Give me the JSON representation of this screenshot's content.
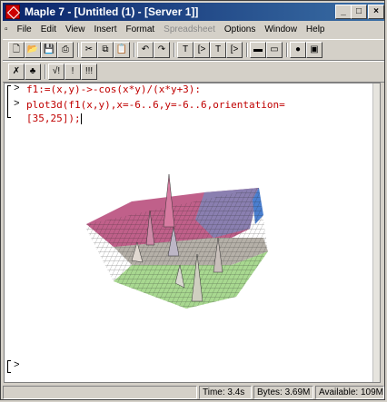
{
  "window": {
    "title": "Maple 7 - [Untitled (1) - [Server 1]]"
  },
  "menu": [
    "File",
    "Edit",
    "View",
    "Insert",
    "Format",
    "Spreadsheet",
    "Options",
    "Window",
    "Help"
  ],
  "menu_disabled": [
    "Spreadsheet"
  ],
  "toolbar1": [
    {
      "name": "new-icon",
      "glyph": "🗋"
    },
    {
      "name": "open-icon",
      "glyph": "📂"
    },
    {
      "name": "save-icon",
      "glyph": "💾"
    },
    {
      "name": "print-icon",
      "glyph": "⎙"
    },
    {
      "name": "cut-icon",
      "glyph": "✂"
    },
    {
      "name": "copy-icon",
      "glyph": "⧉"
    },
    {
      "name": "paste-icon",
      "glyph": "📋"
    },
    {
      "name": "undo-icon",
      "glyph": "↶"
    },
    {
      "name": "redo-icon",
      "glyph": "↷"
    },
    {
      "name": "text-mode-icon",
      "glyph": "T"
    },
    {
      "name": "input-mode-icon",
      "glyph": "[>"
    },
    {
      "name": "insert-text-icon",
      "glyph": "T"
    },
    {
      "name": "new-group-icon",
      "glyph": "[>"
    },
    {
      "name": "collapse-section-icon",
      "glyph": "▬"
    },
    {
      "name": "expand-section-icon",
      "glyph": "▭"
    },
    {
      "name": "stop-icon",
      "glyph": "●"
    },
    {
      "name": "restart-icon",
      "glyph": "▣"
    }
  ],
  "toolbar2": [
    {
      "name": "calc-icon",
      "glyph": "✗"
    },
    {
      "name": "tree-icon",
      "glyph": "♣"
    },
    {
      "name": "sqrt-icon",
      "glyph": "√!"
    },
    {
      "name": "exec-icon",
      "glyph": "!"
    },
    {
      "name": "exec-all-icon",
      "glyph": "!!!"
    }
  ],
  "worksheet": {
    "prompt1": ">",
    "line1": "f1:=(x,y)->-cos(x*y)/(x*y+3):",
    "prompt2": ">",
    "line2": "plot3d(f1(x,y),x=-6..6,y=-6..6,orientation=",
    "line3": "[35,25]);",
    "prompt3": ">"
  },
  "plot": {
    "type": "3d-surface",
    "function": "f1(x,y)",
    "x_range": [
      -6,
      6
    ],
    "y_range": [
      -6,
      6
    ],
    "orientation": [
      35,
      25
    ],
    "colors": [
      "#c0608a",
      "#8a7fb0",
      "#b5b0a8",
      "#a8d890",
      "#4a7fd0"
    ]
  },
  "status": {
    "time": "Time: 3.4s",
    "bytes": "Bytes: 3.69M",
    "available": "Available: 109M"
  }
}
